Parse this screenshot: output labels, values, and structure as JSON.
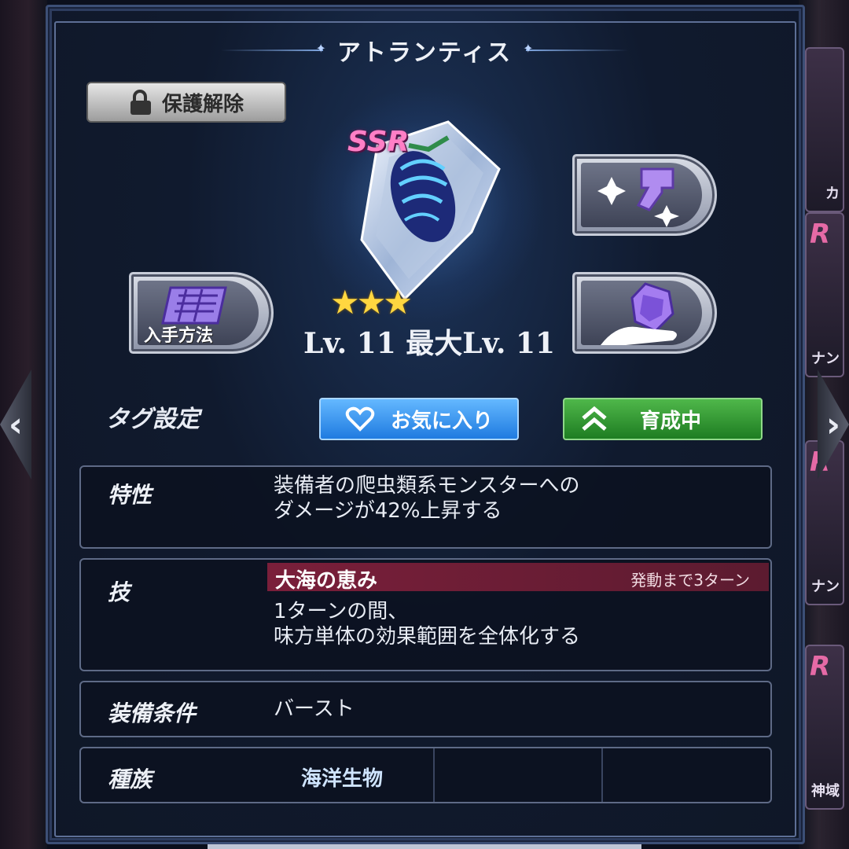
{
  "window": {
    "title": "アトランティス"
  },
  "item": {
    "rarity": "SSR",
    "stars": "★★★",
    "level_text": "Lv. 11  最大Lv. 11"
  },
  "buttons": {
    "protect_label": "保護解除",
    "obtain_label": "入手方法",
    "favorite_label": "お気に入り",
    "training_label": "育成中"
  },
  "tags": {
    "label": "タグ設定"
  },
  "trait": {
    "label": "特性",
    "text_line1": "装備者の爬虫類系モンスターへの",
    "text_line2": "ダメージが42%上昇する"
  },
  "skill": {
    "label": "技",
    "name": "大海の恵み",
    "turns": "発動まで3ターン",
    "text_line1": "1ターンの間、",
    "text_line2": "味方単体の効果範囲を全体化する"
  },
  "equip_condition": {
    "label": "装備条件",
    "value": "バースト"
  },
  "race": {
    "label": "種族",
    "value": "海洋生物"
  },
  "side_cards": [
    "カ",
    "ナン",
    "ナン",
    "神域"
  ],
  "colors": {
    "ssr_pink": "#ff7fc6",
    "favorite_blue": "#1f7be0",
    "training_green": "#1e7d22",
    "skill_header": "#7a1f3a"
  }
}
